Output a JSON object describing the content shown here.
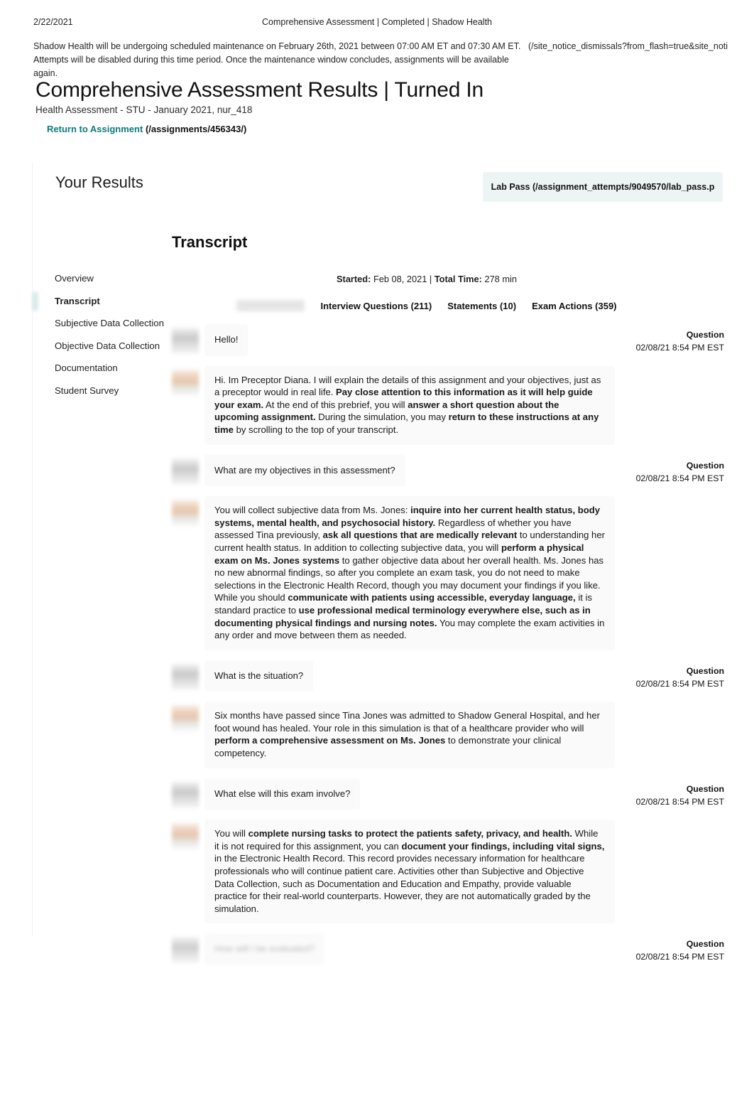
{
  "print_header": {
    "date": "2/22/2021",
    "title": "Comprehensive Assessment | Completed | Shadow Health"
  },
  "site_notice": {
    "text": "Shadow Health will be undergoing scheduled maintenance on February 26th, 2021 between 07:00 AM ET and 07:30 AM ET. Attempts will be disabled during this time period. Once the maintenance window concludes, assignments will be available again.",
    "link_url": "(/site_notice_dismissals?from_flash=true&site_noti"
  },
  "page": {
    "title": "Comprehensive Assessment Results | Turned In",
    "subtitle": "Health Assessment - STU - January 2021, nur_418",
    "return_link_label": "Return to Assignment",
    "return_link_url": "(/assignments/456343/)"
  },
  "results": {
    "heading": "Your Results",
    "lab_pass_label": "Lab Pass (/assignment_attempts/9049570/lab_pass.p"
  },
  "sidebar": {
    "items": [
      {
        "label": "Overview",
        "active": false
      },
      {
        "label": "Transcript",
        "active": true
      },
      {
        "label": "Subjective Data Collection",
        "active": false
      },
      {
        "label": "Objective Data Collection",
        "active": false
      },
      {
        "label": "Documentation",
        "active": false
      },
      {
        "label": "Student Survey",
        "active": false
      }
    ]
  },
  "transcript": {
    "title": "Transcript",
    "started_label": "Started:",
    "started_value": "Feb 08, 2021",
    "separator": "|",
    "total_time_label": "Total Time:",
    "total_time_value": "278 min",
    "filters": [
      {
        "label": "Interview Questions (211)"
      },
      {
        "label": "Statements (10)"
      },
      {
        "label": "Exam Actions (359)"
      }
    ],
    "messages": [
      {
        "speaker": "student",
        "kind": "Question",
        "time": "02/08/21 8:54 PM EST",
        "show_meta": true,
        "faded": false,
        "parts": [
          {
            "text": "Hello!",
            "bold": false
          }
        ]
      },
      {
        "speaker": "preceptor",
        "kind": "",
        "time": "",
        "show_meta": false,
        "faded": false,
        "parts": [
          {
            "text": "Hi. Im Preceptor Diana. I will explain the details of this assignment and your objectives, just as a preceptor would in real life. ",
            "bold": false
          },
          {
            "text": "Pay close attention to this information as it will help guide your exam.",
            "bold": true
          },
          {
            "text": " At the end of this prebrief, you will ",
            "bold": false
          },
          {
            "text": "answer a short question about the upcoming assignment.",
            "bold": true
          },
          {
            "text": " During the simulation, you may ",
            "bold": false
          },
          {
            "text": "return to these instructions at any time",
            "bold": true
          },
          {
            "text": " by scrolling to the top of your transcript.",
            "bold": false
          }
        ]
      },
      {
        "speaker": "student",
        "kind": "Question",
        "time": "02/08/21 8:54 PM EST",
        "show_meta": true,
        "faded": false,
        "parts": [
          {
            "text": "What are my objectives in this assessment?",
            "bold": false
          }
        ]
      },
      {
        "speaker": "preceptor",
        "kind": "",
        "time": "",
        "show_meta": false,
        "faded": false,
        "parts": [
          {
            "text": "You will collect subjective data from Ms. Jones: ",
            "bold": false
          },
          {
            "text": "inquire into her current health status, body systems, mental health, and psychosocial history.",
            "bold": true
          },
          {
            "text": " Regardless of whether you have assessed Tina previously, ",
            "bold": false
          },
          {
            "text": "ask all questions that are medically relevant",
            "bold": true
          },
          {
            "text": " to understanding her current health status. In addition to collecting subjective data, you will ",
            "bold": false
          },
          {
            "text": "perform a physical exam on Ms. Jones systems",
            "bold": true
          },
          {
            "text": " to gather objective data about her overall health. Ms. Jones has no new abnormal findings, so after you complete an exam task, you do not need to make selections in the Electronic Health Record, though you may document your findings if you like. While you should ",
            "bold": false
          },
          {
            "text": "communicate with patients using accessible, everyday language,",
            "bold": true
          },
          {
            "text": " it is standard practice to ",
            "bold": false
          },
          {
            "text": "use professional medical terminology everywhere else, such as in documenting physical findings and nursing notes.",
            "bold": true
          },
          {
            "text": " You may complete the exam activities in any order and move between them as needed.",
            "bold": false
          }
        ]
      },
      {
        "speaker": "student",
        "kind": "Question",
        "time": "02/08/21 8:54 PM EST",
        "show_meta": true,
        "faded": false,
        "parts": [
          {
            "text": "What is the situation?",
            "bold": false
          }
        ]
      },
      {
        "speaker": "preceptor",
        "kind": "",
        "time": "",
        "show_meta": false,
        "faded": false,
        "parts": [
          {
            "text": "Six months have passed since Tina Jones was admitted to Shadow General Hospital, and her foot wound has healed. Your role in this simulation is that of a healthcare provider who will ",
            "bold": false
          },
          {
            "text": "perform a comprehensive assessment on Ms. Jones",
            "bold": true
          },
          {
            "text": " to demonstrate your clinical competency.",
            "bold": false
          }
        ]
      },
      {
        "speaker": "student",
        "kind": "Question",
        "time": "02/08/21 8:54 PM EST",
        "show_meta": true,
        "faded": false,
        "parts": [
          {
            "text": "What else will this exam involve?",
            "bold": false
          }
        ]
      },
      {
        "speaker": "preceptor",
        "kind": "",
        "time": "",
        "show_meta": false,
        "faded": false,
        "parts": [
          {
            "text": "You will ",
            "bold": false
          },
          {
            "text": "complete nursing tasks to protect the patients safety, privacy, and health.",
            "bold": true
          },
          {
            "text": " While it is not required for this assignment, you can ",
            "bold": false
          },
          {
            "text": "document your findings, including vital signs,",
            "bold": true
          },
          {
            "text": " in the Electronic Health Record. This record provides necessary information for healthcare professionals who will continue patient care. Activities other than Subjective and Objective Data Collection, such as Documentation and Education and Empathy, provide valuable practice for their real-world counterparts. However, they are not automatically graded by the simulation.",
            "bold": false
          }
        ]
      },
      {
        "speaker": "student",
        "kind": "Question",
        "time": "02/08/21 8:54 PM EST",
        "show_meta": true,
        "faded": true,
        "parts": [
          {
            "text": "How will I be evaluated?",
            "bold": false
          }
        ]
      }
    ]
  },
  "colors": {
    "accent_teal": "#0d7a7a",
    "lab_pass_bg": "#edf5f4",
    "bubble_bg": "#fafafa",
    "active_indicator": "#d9ecea"
  }
}
